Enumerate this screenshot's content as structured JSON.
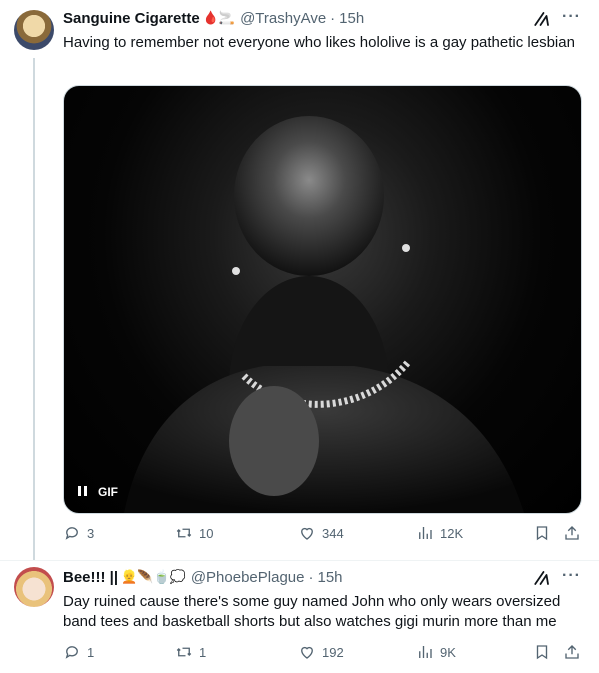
{
  "tweets": [
    {
      "name": "Sanguine Cigarette",
      "name_emojis": "🩸🚬",
      "handle": "@TrashyAve",
      "time": "15h",
      "text": "Having to remember not everyone who likes hololive is a gay pathetic lesbian",
      "media": {
        "type": "GIF",
        "gif_label": "GIF"
      },
      "stats": {
        "replies": "3",
        "retweets": "10",
        "likes": "344",
        "views": "12K"
      }
    },
    {
      "name": "Bee!!! ||",
      "name_emojis": "👱🪶🍵💭",
      "handle": "@PhoebePlague",
      "time": "15h",
      "text": "Day ruined cause there's some guy named John who only wears oversized band tees and basketball shorts but also watches gigi murin more than me",
      "stats": {
        "replies": "1",
        "retweets": "1",
        "likes": "192",
        "views": "9K"
      }
    }
  ],
  "icons": {
    "reply": "reply-icon",
    "retweet": "retweet-icon",
    "like": "heart-icon",
    "views": "views-icon",
    "bookmark": "bookmark-icon",
    "share": "share-icon",
    "grok": "grok-icon",
    "more": "more-icon"
  },
  "colors": {
    "text": "#0f1419",
    "secondary": "#536471",
    "thread": "#cfd9de"
  }
}
